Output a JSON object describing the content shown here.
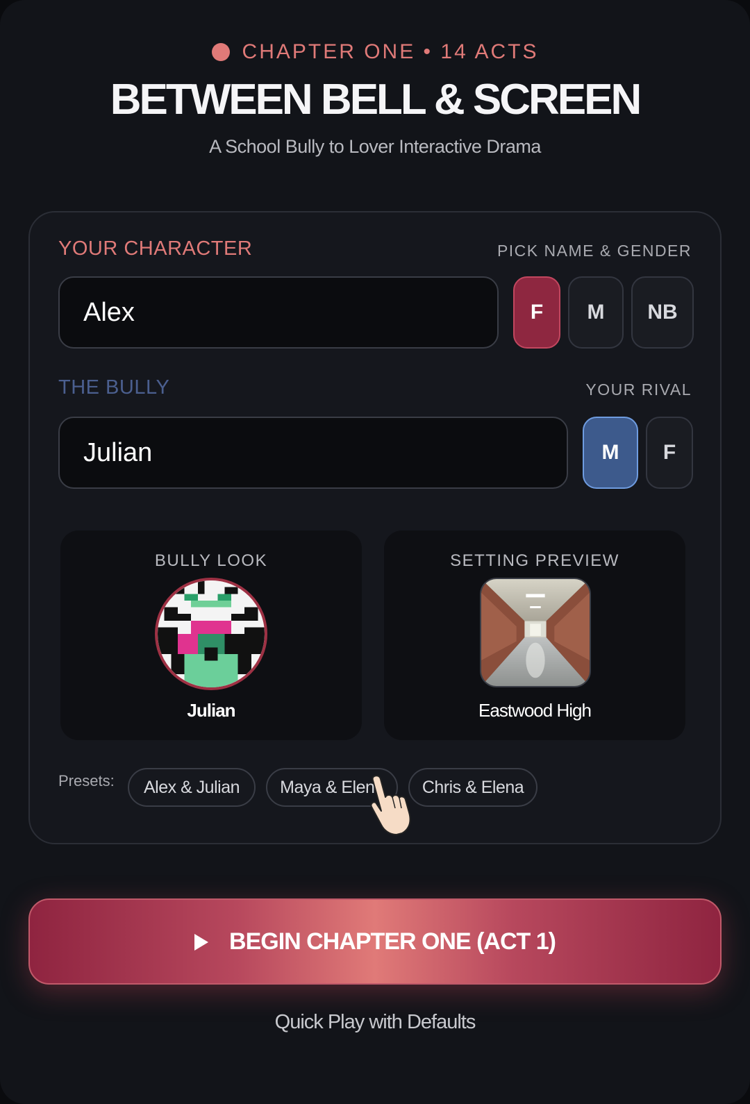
{
  "header": {
    "kicker": "CHAPTER ONE • 14 ACTS",
    "title": "BETWEEN BELL & SCREEN",
    "subtitle": "A School Bully to Lover Interactive Drama"
  },
  "colors": {
    "accent_red": "#e07a78",
    "active_red": "#8e2740",
    "active_blue": "#3d5a8c",
    "bully_label": "#4b5f8f",
    "background": "#121419"
  },
  "character": {
    "label": "YOUR CHARACTER",
    "hint": "PICK NAME & GENDER",
    "name_value": "Alex",
    "gender_options": [
      "F",
      "M",
      "NB"
    ],
    "selected_gender": "F"
  },
  "bully": {
    "label": "THE BULLY",
    "hint": "YOUR RIVAL",
    "name_value": "Julian",
    "gender_options": [
      "M",
      "F"
    ],
    "selected_gender": "M"
  },
  "cards": {
    "bully_look": {
      "label": "BULLY LOOK",
      "name": "Julian"
    },
    "setting_preview": {
      "label": "SETTING PREVIEW",
      "name": "Eastwood High"
    }
  },
  "presets": {
    "label": "Presets:",
    "items": [
      "Alex & Julian",
      "Maya & Elena",
      "Chris & Elena"
    ]
  },
  "cta": {
    "label": "BEGIN CHAPTER ONE (ACT 1)"
  },
  "quick_play": {
    "label": "Quick Play with Defaults"
  }
}
